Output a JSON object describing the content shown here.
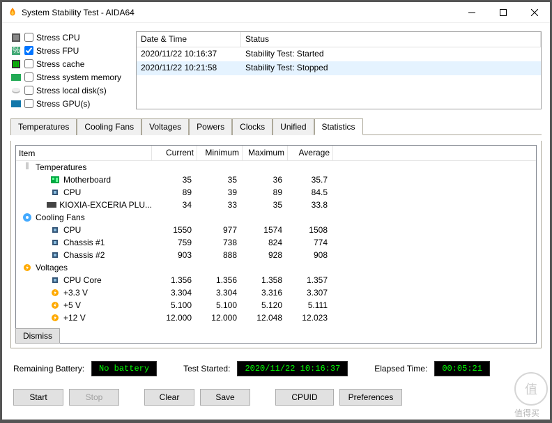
{
  "window": {
    "title": "System Stability Test - AIDA64"
  },
  "stress": {
    "items": [
      {
        "label": "Stress CPU",
        "checked": false
      },
      {
        "label": "Stress FPU",
        "checked": true
      },
      {
        "label": "Stress cache",
        "checked": false
      },
      {
        "label": "Stress system memory",
        "checked": false
      },
      {
        "label": "Stress local disk(s)",
        "checked": false
      },
      {
        "label": "Stress GPU(s)",
        "checked": false
      }
    ]
  },
  "log": {
    "headers": {
      "datetime": "Date & Time",
      "status": "Status"
    },
    "rows": [
      {
        "datetime": "2020/11/22 10:16:37",
        "status": "Stability Test: Started",
        "selected": false
      },
      {
        "datetime": "2020/11/22 10:21:58",
        "status": "Stability Test: Stopped",
        "selected": true
      }
    ]
  },
  "tabs": [
    "Temperatures",
    "Cooling Fans",
    "Voltages",
    "Powers",
    "Clocks",
    "Unified",
    "Statistics"
  ],
  "activeTab": "Statistics",
  "statHeaders": {
    "item": "Item",
    "current": "Current",
    "minimum": "Minimum",
    "maximum": "Maximum",
    "average": "Average"
  },
  "stats": [
    {
      "type": "group",
      "icon": "therm",
      "label": "Temperatures"
    },
    {
      "type": "child",
      "icon": "mb",
      "label": "Motherboard",
      "c": "35",
      "mn": "35",
      "mx": "36",
      "av": "35.7"
    },
    {
      "type": "child",
      "icon": "cpu",
      "label": "CPU",
      "c": "89",
      "mn": "39",
      "mx": "89",
      "av": "84.5"
    },
    {
      "type": "child",
      "icon": "ssd",
      "label": "KIOXIA-EXCERIA PLU...",
      "c": "34",
      "mn": "33",
      "mx": "35",
      "av": "33.8"
    },
    {
      "type": "group",
      "icon": "fan",
      "label": "Cooling Fans"
    },
    {
      "type": "child",
      "icon": "cpu",
      "label": "CPU",
      "c": "1550",
      "mn": "977",
      "mx": "1574",
      "av": "1508"
    },
    {
      "type": "child",
      "icon": "cpu",
      "label": "Chassis #1",
      "c": "759",
      "mn": "738",
      "mx": "824",
      "av": "774"
    },
    {
      "type": "child",
      "icon": "cpu",
      "label": "Chassis #2",
      "c": "903",
      "mn": "888",
      "mx": "928",
      "av": "908"
    },
    {
      "type": "group",
      "icon": "volt",
      "label": "Voltages"
    },
    {
      "type": "child",
      "icon": "cpu",
      "label": "CPU Core",
      "c": "1.356",
      "mn": "1.356",
      "mx": "1.358",
      "av": "1.357"
    },
    {
      "type": "child",
      "icon": "volt",
      "label": "+3.3 V",
      "c": "3.304",
      "mn": "3.304",
      "mx": "3.316",
      "av": "3.307"
    },
    {
      "type": "child",
      "icon": "volt",
      "label": "+5 V",
      "c": "5.100",
      "mn": "5.100",
      "mx": "5.120",
      "av": "5.111"
    },
    {
      "type": "child",
      "icon": "volt",
      "label": "+12 V",
      "c": "12.000",
      "mn": "12.000",
      "mx": "12.048",
      "av": "12.023"
    }
  ],
  "dismiss": "Dismiss",
  "status": {
    "battery_label": "Remaining Battery:",
    "battery_value": "No battery",
    "started_label": "Test Started:",
    "started_value": "2020/11/22 10:16:37",
    "elapsed_label": "Elapsed Time:",
    "elapsed_value": "00:05:21"
  },
  "buttons": {
    "start": "Start",
    "stop": "Stop",
    "clear": "Clear",
    "save": "Save",
    "cpuid": "CPUID",
    "prefs": "Preferences"
  },
  "watermark": "值得买"
}
